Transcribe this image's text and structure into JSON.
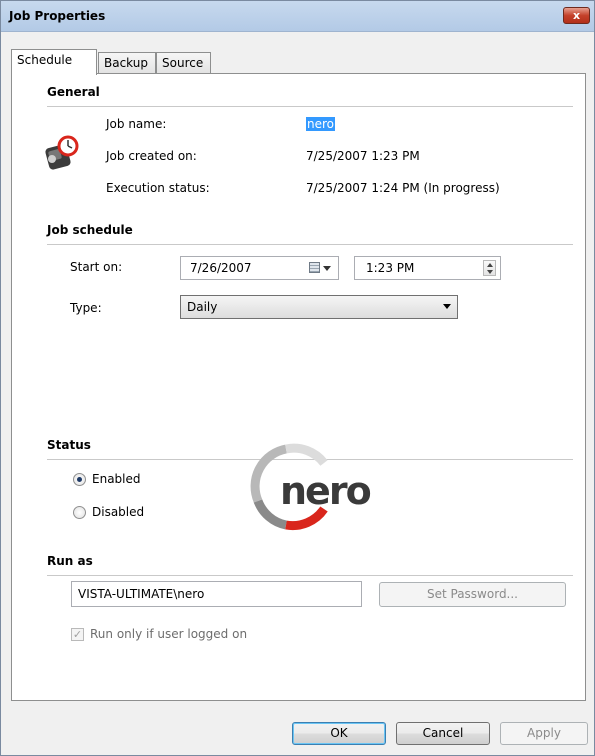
{
  "window": {
    "title": "Job Properties",
    "close_label": "x"
  },
  "tabs": [
    {
      "label": "Schedule",
      "active": true
    },
    {
      "label": "Backup",
      "active": false
    },
    {
      "label": "Source",
      "active": false
    }
  ],
  "general": {
    "heading": "General",
    "job_name_label": "Job name:",
    "job_name_value": "nero",
    "created_label": "Job created on:",
    "created_value": "7/25/2007 1:23 PM",
    "exec_label": "Execution status:",
    "exec_value": "7/25/2007 1:24 PM (In progress)"
  },
  "schedule": {
    "heading": "Job schedule",
    "start_label": "Start on:",
    "start_date": "7/26/2007",
    "start_time": "1:23 PM",
    "type_label": "Type:",
    "type_value": "Daily"
  },
  "status": {
    "heading": "Status",
    "enabled_label": "Enabled",
    "disabled_label": "Disabled",
    "selected": "Enabled"
  },
  "run_as": {
    "heading": "Run as",
    "account_value": "VISTA-ULTIMATE\\nero",
    "set_password_label": "Set Password...",
    "run_only_label": "Run only if user logged on",
    "run_only_checked": true
  },
  "logo": {
    "text": "nero"
  },
  "buttons": {
    "ok": "OK",
    "cancel": "Cancel",
    "apply": "Apply"
  },
  "colors": {
    "selection": "#3399ff",
    "logo_red": "#d9261c",
    "logo_gray": "#8a8a8a"
  },
  "icons": {
    "job": "scheduled-backup-icon",
    "close": "close-icon"
  }
}
